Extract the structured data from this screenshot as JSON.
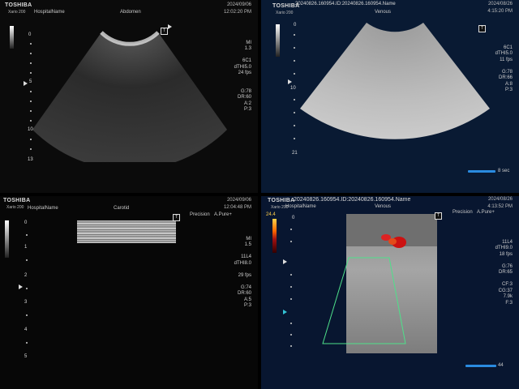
{
  "q1": {
    "brand": "TOSHIBA",
    "model": "Xario 200",
    "hospital": "HospitalName",
    "exam": "Abdomen",
    "date": "2024/09/06",
    "time": "12:02:20 PM",
    "params": [
      "MI",
      "1.3",
      "6C1",
      "dTHI5.0",
      "24 fps",
      "",
      "",
      "G:78",
      "DR:60",
      "A:2",
      "P:3"
    ],
    "depth_labels": [
      "0",
      "5",
      "10",
      "13"
    ],
    "focus_chip": "T"
  },
  "q2": {
    "brand": "TOSHIBA",
    "model": "Xario 200",
    "title_id": "20240826.160954.ID:20240826.160954.Name",
    "exam": "Venous",
    "date": "2024/08/26",
    "time": "4:15:20 PM",
    "params": [
      "6C1",
      "dTHI5.0",
      "11 fps",
      "",
      "G:78",
      "DR:66",
      "A:8",
      "P:3"
    ],
    "depth_labels": [
      "0",
      "10",
      "21"
    ],
    "focus_chip": "T",
    "footer_value": "8 sec"
  },
  "q3": {
    "brand": "TOSHIBA",
    "model": "Xario 200",
    "hospital": "HospitalName",
    "exam": "Carotid",
    "date": "2024/09/06",
    "time": "12:04:48 PM",
    "mode_left": "Precision",
    "mode_right": "A.Pure+",
    "params": [
      "MI",
      "1.5",
      "",
      "11L4",
      "dTHI8.0",
      "",
      "29 fps",
      "",
      "G:74",
      "DR:60",
      "A:5",
      "P:3"
    ],
    "depth_labels": [
      "0",
      "1",
      "2",
      "3",
      "4",
      "5"
    ],
    "focus_chip": "T"
  },
  "q4": {
    "brand": "TOSHIBA",
    "model": "Xario 200",
    "title_id": "20240826.160954.ID:20240826.160954.Name",
    "hospital": "HospitalName",
    "exam": "Venous",
    "date": "2024/08/26",
    "time": "4:13:52 PM",
    "mode_left": "Precision",
    "mode_right": "A.Pure+",
    "scale_top": "24.4",
    "params": [
      "11L4",
      "dTHI9.0",
      "18 fps",
      "",
      "G:76",
      "DR:65",
      "",
      "CF:3",
      "CG:37",
      "7.9k",
      "F:3"
    ],
    "depth_labels": [
      "0"
    ],
    "focus_chip": "T",
    "footer_value": "44"
  }
}
